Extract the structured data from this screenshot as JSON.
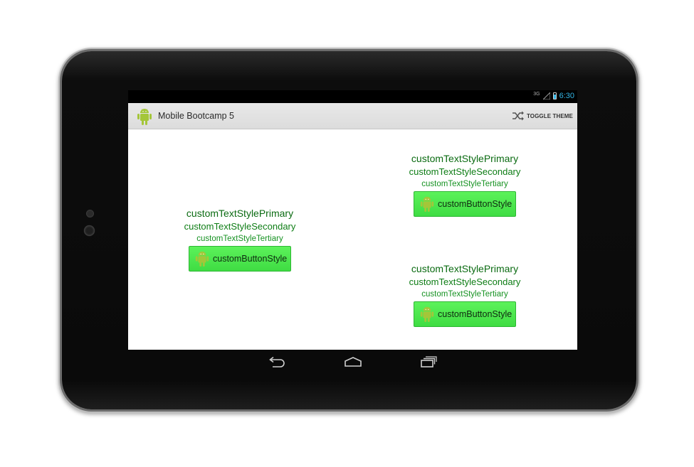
{
  "status_bar": {
    "network": "3G",
    "time": "6:30"
  },
  "action_bar": {
    "title": "Mobile Bootcamp 5",
    "toggle_label": "TOGGLE THEME",
    "app_icon": "android-robot-icon",
    "toggle_icon": "shuffle-icon"
  },
  "groups": [
    {
      "primary": "customTextStylePrimary",
      "secondary": "customTextStyleSecondary",
      "tertiary": "customTextStyleTertiary",
      "button_label": "customButtonStyle"
    },
    {
      "primary": "customTextStylePrimary",
      "secondary": "customTextStyleSecondary",
      "tertiary": "customTextStyleTertiary",
      "button_label": "customButtonStyle"
    },
    {
      "primary": "customTextStylePrimary",
      "secondary": "customTextStyleSecondary",
      "tertiary": "customTextStyleTertiary",
      "button_label": "customButtonStyle"
    }
  ],
  "nav_bar": [
    "back-icon",
    "home-icon",
    "recent-apps-icon"
  ],
  "colors": {
    "text_primary": "#0b6b12",
    "text_secondary": "#0e7d15",
    "text_tertiary": "#169222",
    "button_fill": "#4ae64b",
    "android_green": "#a4c639",
    "holo_blue": "#33b5e5"
  }
}
